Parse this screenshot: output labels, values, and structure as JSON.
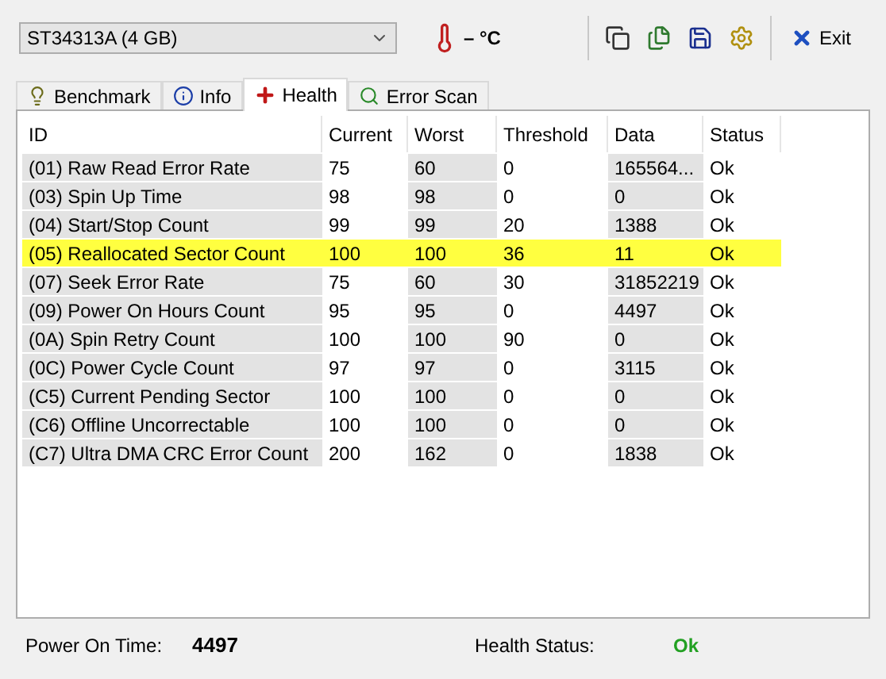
{
  "drive_select": {
    "value": "ST34313A (4 GB)"
  },
  "temperature": "– °C",
  "exit_button": "Exit",
  "tabs": [
    {
      "label": "Benchmark",
      "selected": false,
      "kind": "bulb"
    },
    {
      "label": "Info",
      "selected": false,
      "kind": "info"
    },
    {
      "label": "Health",
      "selected": true,
      "kind": "cross"
    },
    {
      "label": "Error Scan",
      "selected": false,
      "kind": "scan"
    }
  ],
  "table": {
    "columns": [
      {
        "label": "ID",
        "shaded": true
      },
      {
        "label": "Current",
        "shaded": false
      },
      {
        "label": "Worst",
        "shaded": true
      },
      {
        "label": "Threshold",
        "shaded": false
      },
      {
        "label": "Data",
        "shaded": true
      },
      {
        "label": "Status",
        "shaded": false
      }
    ],
    "rows": [
      {
        "cells": [
          "(01) Raw Read Error Rate",
          "75",
          "60",
          "0",
          "165564...",
          "Ok"
        ],
        "selected": false
      },
      {
        "cells": [
          "(03) Spin Up Time",
          "98",
          "98",
          "0",
          "0",
          "Ok"
        ],
        "selected": false
      },
      {
        "cells": [
          "(04) Start/Stop Count",
          "99",
          "99",
          "20",
          "1388",
          "Ok"
        ],
        "selected": false
      },
      {
        "cells": [
          "(05) Reallocated Sector Count",
          "100",
          "100",
          "36",
          "11",
          "Ok"
        ],
        "selected": true
      },
      {
        "cells": [
          "(07) Seek Error Rate",
          "75",
          "60",
          "30",
          "31852219",
          "Ok"
        ],
        "selected": false
      },
      {
        "cells": [
          "(09) Power On Hours Count",
          "95",
          "95",
          "0",
          "4497",
          "Ok"
        ],
        "selected": false
      },
      {
        "cells": [
          "(0A) Spin Retry Count",
          "100",
          "100",
          "90",
          "0",
          "Ok"
        ],
        "selected": false
      },
      {
        "cells": [
          "(0C) Power Cycle Count",
          "97",
          "97",
          "0",
          "3115",
          "Ok"
        ],
        "selected": false
      },
      {
        "cells": [
          "(C5) Current Pending Sector",
          "100",
          "100",
          "0",
          "0",
          "Ok"
        ],
        "selected": false
      },
      {
        "cells": [
          "(C6) Offline Uncorrectable",
          "100",
          "100",
          "0",
          "0",
          "Ok"
        ],
        "selected": false
      },
      {
        "cells": [
          "(C7) Ultra DMA CRC Error Count",
          "200",
          "162",
          "0",
          "1838",
          "Ok"
        ],
        "selected": false
      }
    ]
  },
  "status_bar": {
    "power_on_time_label": "Power On Time:",
    "power_on_time": "4497",
    "health_status_label": "Health Status:",
    "health_status": "Ok"
  }
}
